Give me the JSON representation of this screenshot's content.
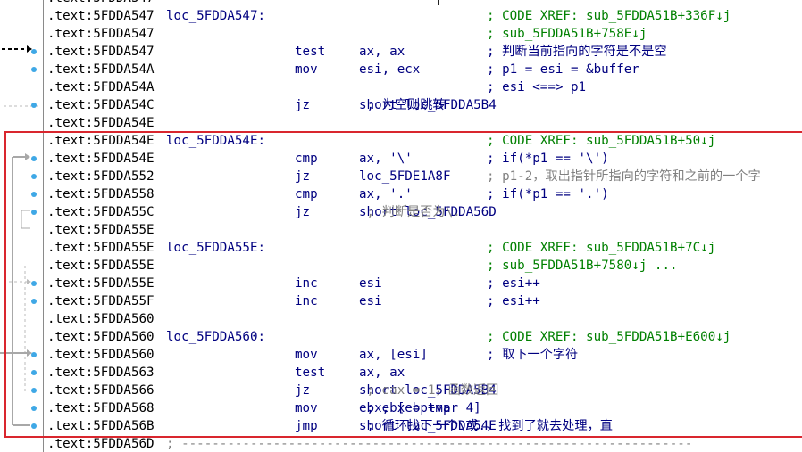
{
  "colors": {
    "address": "#000000",
    "code": "#000080",
    "xref_comment": "#008000",
    "auto_comment": "#808080",
    "selection_box": "#d9262e",
    "flow_dot": "#3fa8e6"
  },
  "lines": [
    {
      "addr": ".text:5FDDA547",
      "label": "",
      "mnem": "",
      "ops": "",
      "comment": "",
      "comment_type": ""
    },
    {
      "addr": ".text:5FDDA547",
      "label": "loc_5FDDA547:",
      "mnem": "",
      "ops": "",
      "comment": "; CODE XREF: sub_5FDDA51B+336F↓j",
      "comment_type": "xref"
    },
    {
      "addr": ".text:5FDDA547",
      "label": "",
      "mnem": "",
      "ops": "",
      "comment": "; sub_5FDDA51B+758E↓j",
      "comment_type": "xref"
    },
    {
      "addr": ".text:5FDDA547",
      "label": "",
      "mnem": "test",
      "ops": "ax, ax",
      "comment": "; 判断当前指向的字符是不是空",
      "comment_type": "user"
    },
    {
      "addr": ".text:5FDDA54A",
      "label": "",
      "mnem": "mov",
      "ops": "esi, ecx",
      "comment": "; p1 = esi = &buffer",
      "comment_type": "user"
    },
    {
      "addr": ".text:5FDDA54A",
      "label": "",
      "mnem": "",
      "ops": "",
      "comment": "; esi <==> p1",
      "comment_type": "user"
    },
    {
      "addr": ".text:5FDDA54C",
      "label": "",
      "mnem": "jz",
      "ops": "short loc_5FDDA5B4",
      "inline_comment": "; 为空则跳转",
      "inline_type": "user"
    },
    {
      "addr": ".text:5FDDA54E",
      "label": "",
      "mnem": "",
      "ops": "",
      "comment": "",
      "comment_type": ""
    },
    {
      "addr": ".text:5FDDA54E",
      "label": "loc_5FDDA54E:",
      "mnem": "",
      "ops": "",
      "comment": "; CODE XREF: sub_5FDDA51B+50↓j",
      "comment_type": "xref"
    },
    {
      "addr": ".text:5FDDA54E",
      "label": "",
      "mnem": "cmp",
      "ops": "ax, '\\'",
      "comment": "; if(*p1 == '\\')",
      "comment_type": "user"
    },
    {
      "addr": ".text:5FDDA552",
      "label": "",
      "mnem": "jz",
      "ops": "loc_5FDE1A8F",
      "comment": "; p1-2，取出指针所指向的字符和之前的一个字",
      "comment_type": "auto"
    },
    {
      "addr": ".text:5FDDA558",
      "label": "",
      "mnem": "cmp",
      "ops": "ax, '.'",
      "comment": "; if(*p1 == '.')",
      "comment_type": "user"
    },
    {
      "addr": ".text:5FDDA55C",
      "label": "",
      "mnem": "jz",
      "ops": "short loc_5FDDA56D",
      "inline_comment": "; 判断是否为\\.",
      "inline_type": "auto"
    },
    {
      "addr": ".text:5FDDA55E",
      "label": "",
      "mnem": "",
      "ops": "",
      "comment": "",
      "comment_type": ""
    },
    {
      "addr": ".text:5FDDA55E",
      "label": "loc_5FDDA55E:",
      "mnem": "",
      "ops": "",
      "comment": "; CODE XREF: sub_5FDDA51B+7C↓j",
      "comment_type": "xref"
    },
    {
      "addr": ".text:5FDDA55E",
      "label": "",
      "mnem": "",
      "ops": "",
      "comment": "; sub_5FDDA51B+7580↓j ...",
      "comment_type": "xref"
    },
    {
      "addr": ".text:5FDDA55E",
      "label": "",
      "mnem": "inc",
      "ops": "esi",
      "comment": "; esi++",
      "comment_type": "user"
    },
    {
      "addr": ".text:5FDDA55F",
      "label": "",
      "mnem": "inc",
      "ops": "esi",
      "comment": "; esi++",
      "comment_type": "user"
    },
    {
      "addr": ".text:5FDDA560",
      "label": "",
      "mnem": "",
      "ops": "",
      "comment": "",
      "comment_type": ""
    },
    {
      "addr": ".text:5FDDA560",
      "label": "loc_5FDDA560:",
      "mnem": "",
      "ops": "",
      "comment": "; CODE XREF: sub_5FDDA51B+E600↓j",
      "comment_type": "xref"
    },
    {
      "addr": ".text:5FDDA560",
      "label": "",
      "mnem": "mov",
      "ops": "ax, [esi]",
      "comment": "; 取下一个字符",
      "comment_type": "user"
    },
    {
      "addr": ".text:5FDDA563",
      "label": "",
      "mnem": "test",
      "ops": "ax, ax",
      "comment": "",
      "comment_type": ""
    },
    {
      "addr": ".text:5FDDA566",
      "label": "",
      "mnem": "jz",
      "ops": "short loc_5FDDA5B4",
      "inline_comment": "; eax = 1，函数返回",
      "inline_type": "auto"
    },
    {
      "addr": ".text:5FDDA568",
      "label": "",
      "mnem": "mov",
      "ops": "ebx, [ebp+var_4]",
      "inline_comment": "; ebx = tmp",
      "inline_type": "user"
    },
    {
      "addr": ".text:5FDDA56B",
      "label": "",
      "mnem": "jmp",
      "ops": "short loc_5FDDA54E",
      "inline_comment": "; 循环找下一个\\或.，找到了就去处理，直",
      "inline_type": "user"
    },
    {
      "addr": ".text:5FDDA56D",
      "label": "",
      "mnem": "",
      "ops": "",
      "inline_comment": "; -------------------------------------------------------------------",
      "inline_type": "auto"
    }
  ]
}
